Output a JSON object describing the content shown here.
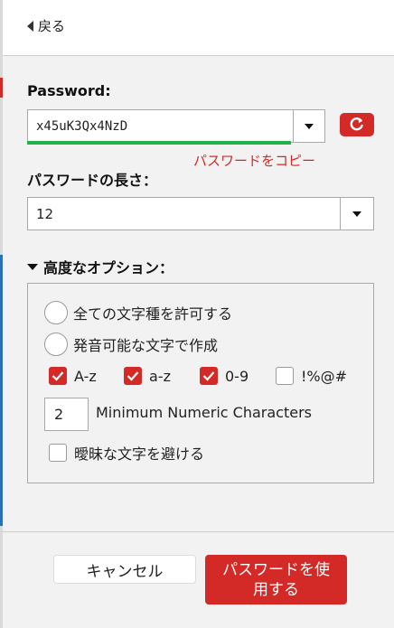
{
  "nav": {
    "back_label": "戻る",
    "back_icon": "chevron-left-icon"
  },
  "password": {
    "label": "Password:",
    "value": "x45uK3Qx4NzD",
    "strength_color": "#22b24a",
    "copy_label": "パスワードをコピー",
    "refresh_icon": "refresh-icon"
  },
  "length": {
    "label": "パスワードの長さ：",
    "value": "12"
  },
  "advanced": {
    "toggle_label": "高度なオプション：",
    "radios": [
      {
        "label": "全ての文字種を許可する",
        "selected": false
      },
      {
        "label": "発音可能な文字で作成",
        "selected": false
      }
    ],
    "charsets": [
      {
        "label": "A-z",
        "checked": true
      },
      {
        "label": "a-z",
        "checked": true
      },
      {
        "label": "0-9",
        "checked": true
      },
      {
        "label": "!%@#",
        "checked": false
      }
    ],
    "min_numeric": {
      "value": "2",
      "label": "Minimum Numeric Characters"
    },
    "avoid_ambiguous": {
      "label": "曖昧な文字を避ける",
      "checked": false
    }
  },
  "footer": {
    "cancel_label": "キャンセル",
    "use_label": "パスワードを使用する"
  },
  "colors": {
    "accent": "#d42a27",
    "strength": "#22b24a",
    "background": "#f2f2f2"
  }
}
